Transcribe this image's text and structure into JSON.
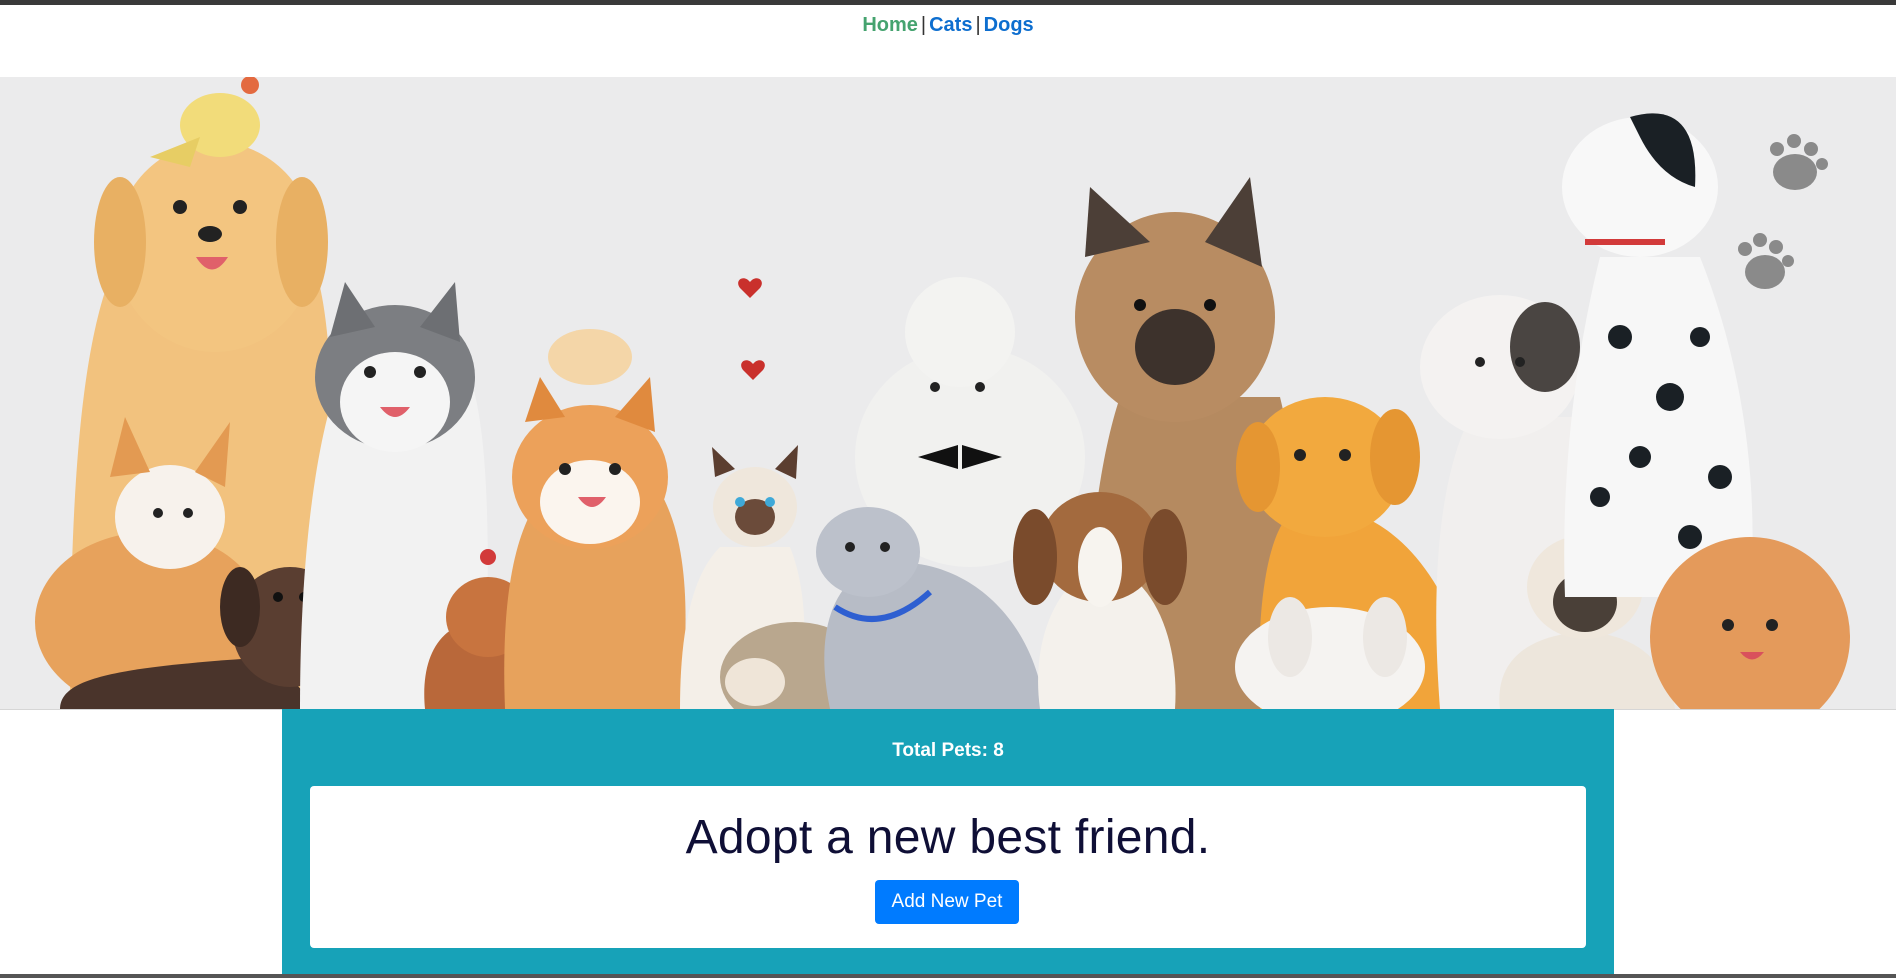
{
  "nav": {
    "home_label": "Home",
    "cats_label": "Cats",
    "dogs_label": "Dogs",
    "separator": "|",
    "active_color": "#45a36f",
    "link_color": "#0d6ecf"
  },
  "hero": {
    "image_description_icon": "pets-banner-illustration"
  },
  "stats": {
    "total_pets": "Total Pets: 8"
  },
  "cta": {
    "headline": "Adopt a new best friend.",
    "add_button": "Add New Pet"
  },
  "colors": {
    "panel": "#17a2b8",
    "button": "#007bff",
    "headline": "#0f0f36"
  }
}
